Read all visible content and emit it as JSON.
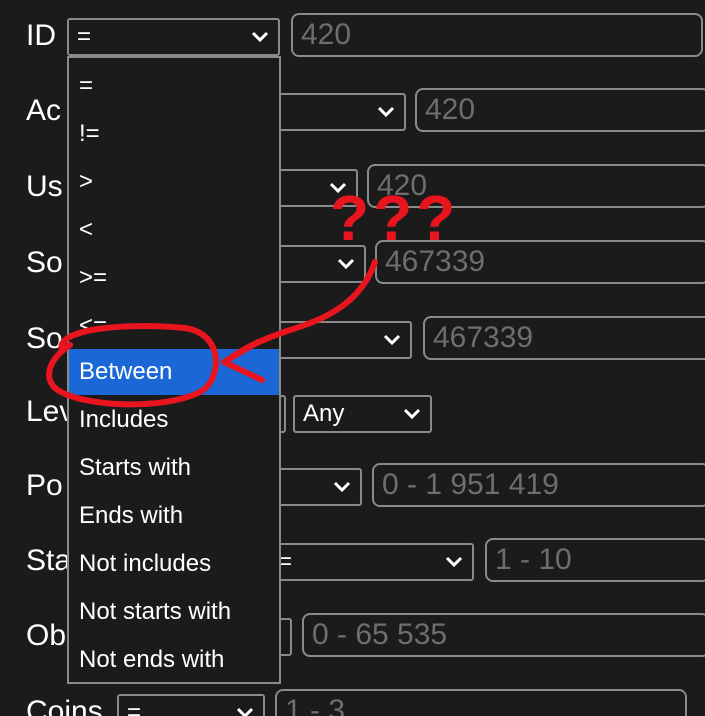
{
  "rows": [
    {
      "label": "ID",
      "select": "=",
      "input": "420"
    },
    {
      "label": "Ac",
      "input": "420"
    },
    {
      "label": "Us",
      "input": "420"
    },
    {
      "label": "So",
      "input": "467339"
    },
    {
      "label": "So",
      "input": "467339"
    },
    {
      "label": "Lev",
      "select2": "Any"
    },
    {
      "label": "Po",
      "input": "0 - 1 951 419"
    },
    {
      "label": "Sta",
      "select_partial": "=",
      "input": "1 - 10"
    },
    {
      "label": "Ob",
      "input": "0 - 65 535"
    },
    {
      "label": "Coins",
      "select": "=",
      "input": "1 - 3"
    }
  ],
  "dropdown": {
    "options": [
      "=",
      "!=",
      ">",
      "<",
      ">=",
      "<=",
      "Between",
      "Includes",
      "Starts with",
      "Ends with",
      "Not includes",
      "Not starts with",
      "Not ends with"
    ],
    "selected": "Between"
  },
  "annotation": {
    "text": "???",
    "color": "#e8141e"
  }
}
